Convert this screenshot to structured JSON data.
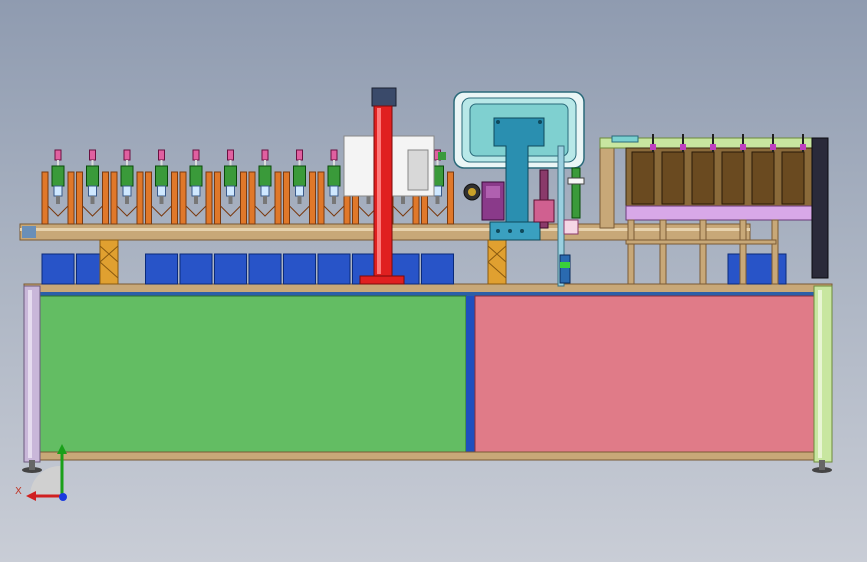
{
  "viewport": {
    "background_top": "#8f9bb0",
    "background_bottom": "#c9cdd6"
  },
  "colors": {
    "frame_profile": "#c8a878",
    "frame_edge": "#7a5a35",
    "panel_left": "#63bd63",
    "panel_right": "#e07b88",
    "panel_divider": "#1e4fbf",
    "leg_lavender": "#c9b7d9",
    "leg_green": "#c8e6a0",
    "cylinder_red": "#e02020",
    "blue_box": "#2854c8",
    "teal_block": "#2a8fb0",
    "orange_bracket": "#e0782a",
    "pink_nozzle": "#e060a0",
    "green_valve": "#3a9a3a",
    "magazine_brown": "#8a6a3a",
    "magazine_lilac": "#d8a8e8",
    "hmi_frame": "#7fd0d0"
  },
  "triad": {
    "x_label": "X",
    "x_axis_icon": "x-axis-arrow-icon",
    "y_axis_icon": "y-axis-arrow-icon",
    "z_axis_icon": "z-axis-dot-icon"
  },
  "stations": {
    "count": 12
  }
}
